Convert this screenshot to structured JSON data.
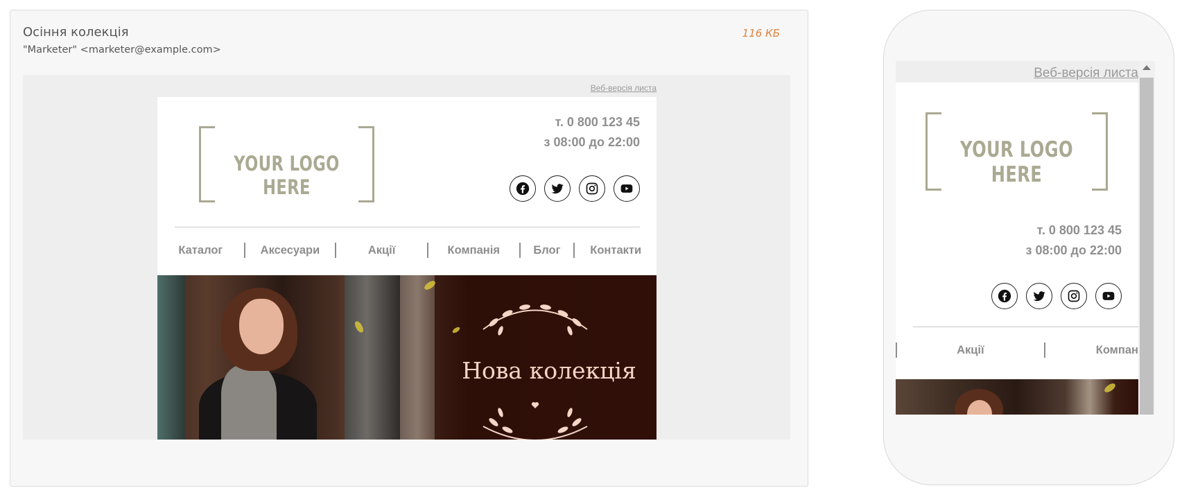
{
  "email": {
    "subject": "Осіння колекція",
    "sender": "\"Marketer\" <marketer@example.com>",
    "size": "116 КБ"
  },
  "template": {
    "web_version_link": "Веб-версія листа",
    "logo_text": "YOUR LOGO HERE",
    "phone": "т. 0 800 123 45",
    "hours": "з 08:00 до 22:00",
    "socials": [
      "facebook-icon",
      "twitter-icon",
      "instagram-icon",
      "youtube-icon"
    ],
    "nav": [
      "Каталог",
      "Аксесуари",
      "Акції",
      "Компанія",
      "Блог",
      "Контакти"
    ],
    "hero_title": "Нова колекція"
  },
  "mobile": {
    "nav_visible": [
      "Акції",
      "Компан"
    ]
  },
  "colors": {
    "accent_size": "#e0823d",
    "logo": "#aaa992",
    "hero_text": "#f4d5c6"
  }
}
